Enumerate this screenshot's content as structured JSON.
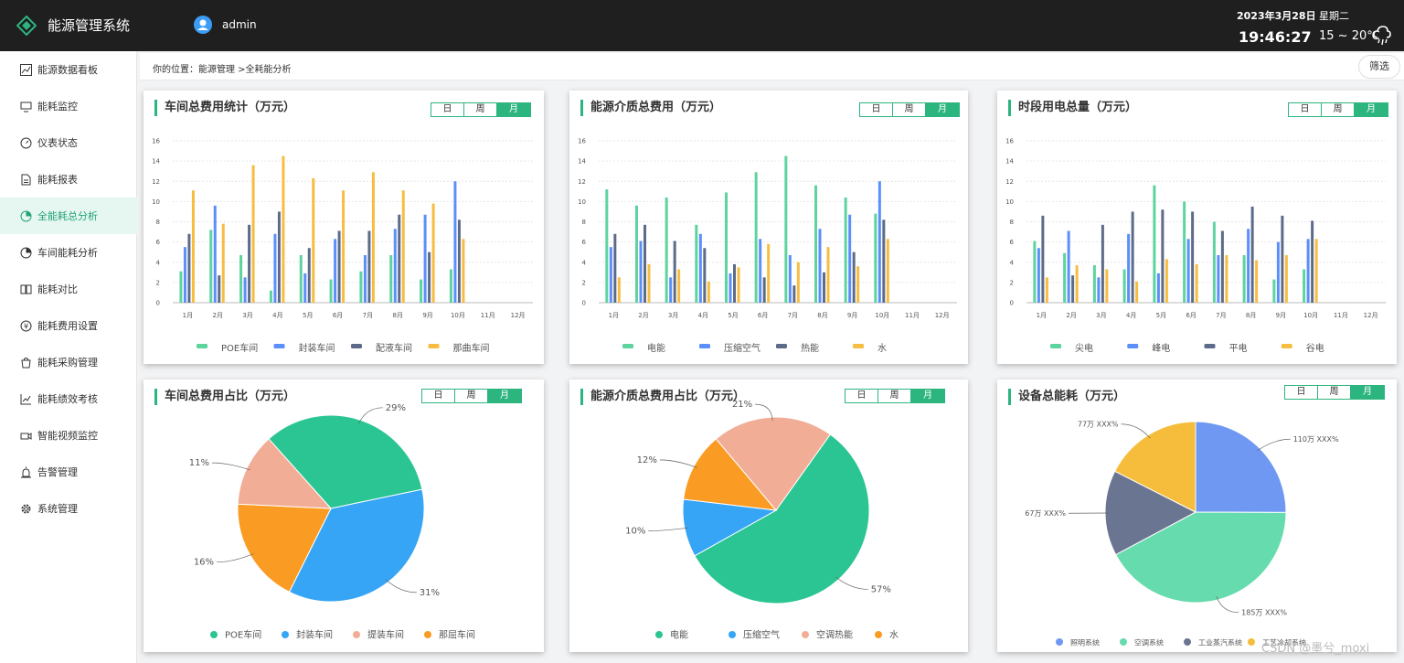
{
  "header": {
    "app_title": "能源管理系统",
    "user": "admin",
    "date": "2023年3月28日",
    "weekday": "星期二",
    "time": "19:46:27",
    "temperature": "15 ~ 20℃"
  },
  "sidebar": {
    "items": [
      {
        "label": "能源数据看板",
        "icon": "chart-line-icon"
      },
      {
        "label": "能耗监控",
        "icon": "monitor-icon"
      },
      {
        "label": "仪表状态",
        "icon": "gauge-icon"
      },
      {
        "label": "能耗报表",
        "icon": "document-icon"
      },
      {
        "label": "全能耗总分析",
        "icon": "pie-icon",
        "active": true
      },
      {
        "label": "车间能耗分析",
        "icon": "pie-icon"
      },
      {
        "label": "能耗对比",
        "icon": "book-icon"
      },
      {
        "label": "能耗费用设置",
        "icon": "coin-icon"
      },
      {
        "label": "能耗采购管理",
        "icon": "bag-icon"
      },
      {
        "label": "能耗绩效考核",
        "icon": "chart-line-icon"
      },
      {
        "label": "智能视频监控",
        "icon": "camera-icon"
      },
      {
        "label": "告警管理",
        "icon": "alarm-icon"
      },
      {
        "label": "系统管理",
        "icon": "gear-icon"
      }
    ]
  },
  "breadcrumb": "你的位置：能源管理 >全耗能分析",
  "filter_label": "筛选",
  "segment": [
    "日",
    "周",
    "月"
  ],
  "accent_color": "#2cb57f",
  "panels": {
    "p1": {
      "title": "车间总费用统计（万元）"
    },
    "p2": {
      "title": "能源介质总费用（万元）"
    },
    "p3": {
      "title": "时段用电总量（万元）"
    },
    "p4": {
      "title": "车间总费用占比（万元）"
    },
    "p5": {
      "title": "能源介质总费用占比（万元）"
    },
    "p6": {
      "title": "设备总能耗（万元）"
    }
  },
  "chart_data": [
    {
      "type": "bar",
      "categories": [
        "1月",
        "2月",
        "3月",
        "4月",
        "5月",
        "6月",
        "7月",
        "8月",
        "9月",
        "10月",
        "11月",
        "12月"
      ],
      "ylim": [
        0,
        16
      ],
      "yticks": [
        0,
        2,
        4,
        6,
        8,
        10,
        12,
        14,
        16
      ],
      "series": [
        {
          "name": "POE车间",
          "color": "#5dd39e",
          "values": [
            3.1,
            7.2,
            4.7,
            1.2,
            4.7,
            2.3,
            3.1,
            4.7,
            2.3,
            3.3,
            0,
            0
          ]
        },
        {
          "name": "封装车间",
          "color": "#5b8ff9",
          "values": [
            5.5,
            9.6,
            2.5,
            6.8,
            2.9,
            6.3,
            4.7,
            7.3,
            8.7,
            12.0,
            0,
            0
          ]
        },
        {
          "name": "配液车间",
          "color": "#5d6b8a",
          "values": [
            6.8,
            2.7,
            7.7,
            9.0,
            5.4,
            7.1,
            7.1,
            8.7,
            5.0,
            8.2,
            0,
            0
          ]
        },
        {
          "name": "那曲车间",
          "color": "#f6bd41",
          "values": [
            11.1,
            7.8,
            13.6,
            14.5,
            12.3,
            11.1,
            12.9,
            11.1,
            9.8,
            6.3,
            0,
            0
          ]
        }
      ]
    },
    {
      "type": "bar",
      "categories": [
        "1月",
        "2月",
        "3月",
        "4月",
        "5月",
        "6月",
        "7月",
        "8月",
        "9月",
        "10月",
        "11月",
        "12月"
      ],
      "ylim": [
        0,
        16
      ],
      "yticks": [
        0,
        2,
        4,
        6,
        8,
        10,
        12,
        14,
        16
      ],
      "series": [
        {
          "name": "电能",
          "color": "#5dd39e",
          "values": [
            11.2,
            9.6,
            10.4,
            7.7,
            10.9,
            12.9,
            14.5,
            11.6,
            10.4,
            8.8,
            0,
            0
          ]
        },
        {
          "name": "压缩空气",
          "color": "#5b8ff9",
          "values": [
            5.5,
            6.1,
            2.5,
            6.8,
            2.9,
            6.3,
            4.7,
            7.3,
            8.7,
            12.0,
            0,
            0
          ]
        },
        {
          "name": "热能",
          "color": "#5d6b8a",
          "values": [
            6.8,
            7.7,
            6.1,
            5.4,
            3.8,
            2.5,
            1.7,
            3.0,
            5.0,
            8.2,
            0,
            0
          ]
        },
        {
          "name": "水",
          "color": "#f6bd41",
          "values": [
            2.5,
            3.8,
            3.3,
            2.1,
            3.5,
            5.8,
            4.0,
            5.5,
            3.6,
            6.3,
            0,
            0
          ]
        }
      ]
    },
    {
      "type": "bar",
      "categories": [
        "1月",
        "2月",
        "3月",
        "4月",
        "5月",
        "6月",
        "7月",
        "8月",
        "9月",
        "10月",
        "11月",
        "12月"
      ],
      "ylim": [
        0,
        16
      ],
      "yticks": [
        0,
        2,
        4,
        6,
        8,
        10,
        12,
        14,
        16
      ],
      "series": [
        {
          "name": "尖电",
          "color": "#5dd39e",
          "values": [
            6.1,
            4.9,
            3.7,
            3.3,
            11.6,
            10.0,
            8.0,
            4.7,
            2.3,
            3.3,
            0,
            0
          ]
        },
        {
          "name": "峰电",
          "color": "#5b8ff9",
          "values": [
            5.4,
            7.1,
            2.5,
            6.8,
            2.9,
            6.3,
            4.7,
            7.3,
            6.0,
            6.3,
            0,
            0
          ]
        },
        {
          "name": "平电",
          "color": "#5d6b8a",
          "values": [
            8.6,
            2.7,
            7.7,
            9.0,
            9.2,
            9.0,
            7.1,
            9.5,
            8.6,
            8.1,
            0,
            0
          ]
        },
        {
          "name": "谷电",
          "color": "#f6bd41",
          "values": [
            2.5,
            3.7,
            3.3,
            2.1,
            4.3,
            3.8,
            4.7,
            4.2,
            4.7,
            6.3,
            0,
            0
          ]
        }
      ]
    },
    {
      "type": "pie",
      "slices": [
        {
          "name": "POE车间",
          "value": 29,
          "label": "29%",
          "color": "#2bc594"
        },
        {
          "name": "封装车间",
          "value": 31,
          "label": "31%",
          "color": "#36a5f5"
        },
        {
          "name": "提装车间",
          "value": 16,
          "label": "16%",
          "color": "#fa9c24"
        },
        {
          "name": "那屈车间",
          "value": 11,
          "label": "11%",
          "color": "#f2ad97"
        }
      ],
      "legend": [
        {
          "name": "POE车间",
          "color": "#2bc594"
        },
        {
          "name": "封装车间",
          "color": "#36a5f5"
        },
        {
          "name": "提装车间",
          "color": "#f2ad97"
        },
        {
          "name": "那屈车间",
          "color": "#fa9c24"
        }
      ]
    },
    {
      "type": "pie",
      "slices": [
        {
          "name": "电能",
          "value": 57,
          "label": "57%",
          "color": "#2bc594"
        },
        {
          "name": "压缩空气",
          "value": 10,
          "label": "10%",
          "color": "#36a5f5"
        },
        {
          "name": "水",
          "value": 12,
          "label": "12%",
          "color": "#fa9c24"
        },
        {
          "name": "空调热能",
          "value": 21,
          "label": "21%",
          "color": "#f2ad97"
        }
      ],
      "legend": [
        {
          "name": "电能",
          "color": "#2bc594"
        },
        {
          "name": "压缩空气",
          "color": "#36a5f5"
        },
        {
          "name": "空调热能",
          "color": "#f2ad97"
        },
        {
          "name": "水",
          "color": "#fa9c24"
        }
      ]
    },
    {
      "type": "pie",
      "slices": [
        {
          "name": "照明系统",
          "value": 110,
          "label": "110万 XXX%",
          "color": "#6f98f2"
        },
        {
          "name": "空调系统",
          "value": 185,
          "label": "185万 XXX%",
          "color": "#66dbad"
        },
        {
          "name": "工业蒸汽系统",
          "value": 67,
          "label": "67万 XXX%",
          "color": "#6a7691"
        },
        {
          "name": "工艺冷却系统",
          "value": 77,
          "label": "77万 XXX%",
          "color": "#f5bd3b"
        }
      ],
      "legend": [
        {
          "name": "照明系统",
          "color": "#6f98f2"
        },
        {
          "name": "空调系统",
          "color": "#66dbad"
        },
        {
          "name": "工业蒸汽系统",
          "color": "#6a7691"
        },
        {
          "name": "工艺冷却系统",
          "color": "#f5bd3b"
        }
      ]
    }
  ],
  "watermark": "CSDN @墨兮_moxi"
}
